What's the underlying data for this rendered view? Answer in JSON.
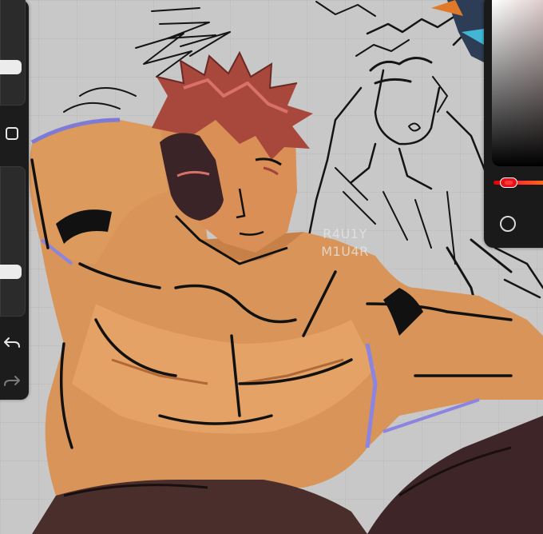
{
  "watermark": {
    "line1": "R4U1Y",
    "line2": "M1U4R"
  },
  "sidebar": {
    "brush_size_level": 0.15,
    "opacity_level": 0.85,
    "modify_button_icon": "square-outline-icon",
    "undo_icon": "undo-arrow-icon",
    "redo_icon": "redo-arrow-icon"
  },
  "color_panel": {
    "selected_color": "#e5121b",
    "hue_gradient": [
      "#e00000",
      "#ff5a1a",
      "#ff8a00"
    ],
    "secondary_color_icon": "circle-outline-icon"
  },
  "canvas": {
    "background": "#c8c8c8"
  }
}
